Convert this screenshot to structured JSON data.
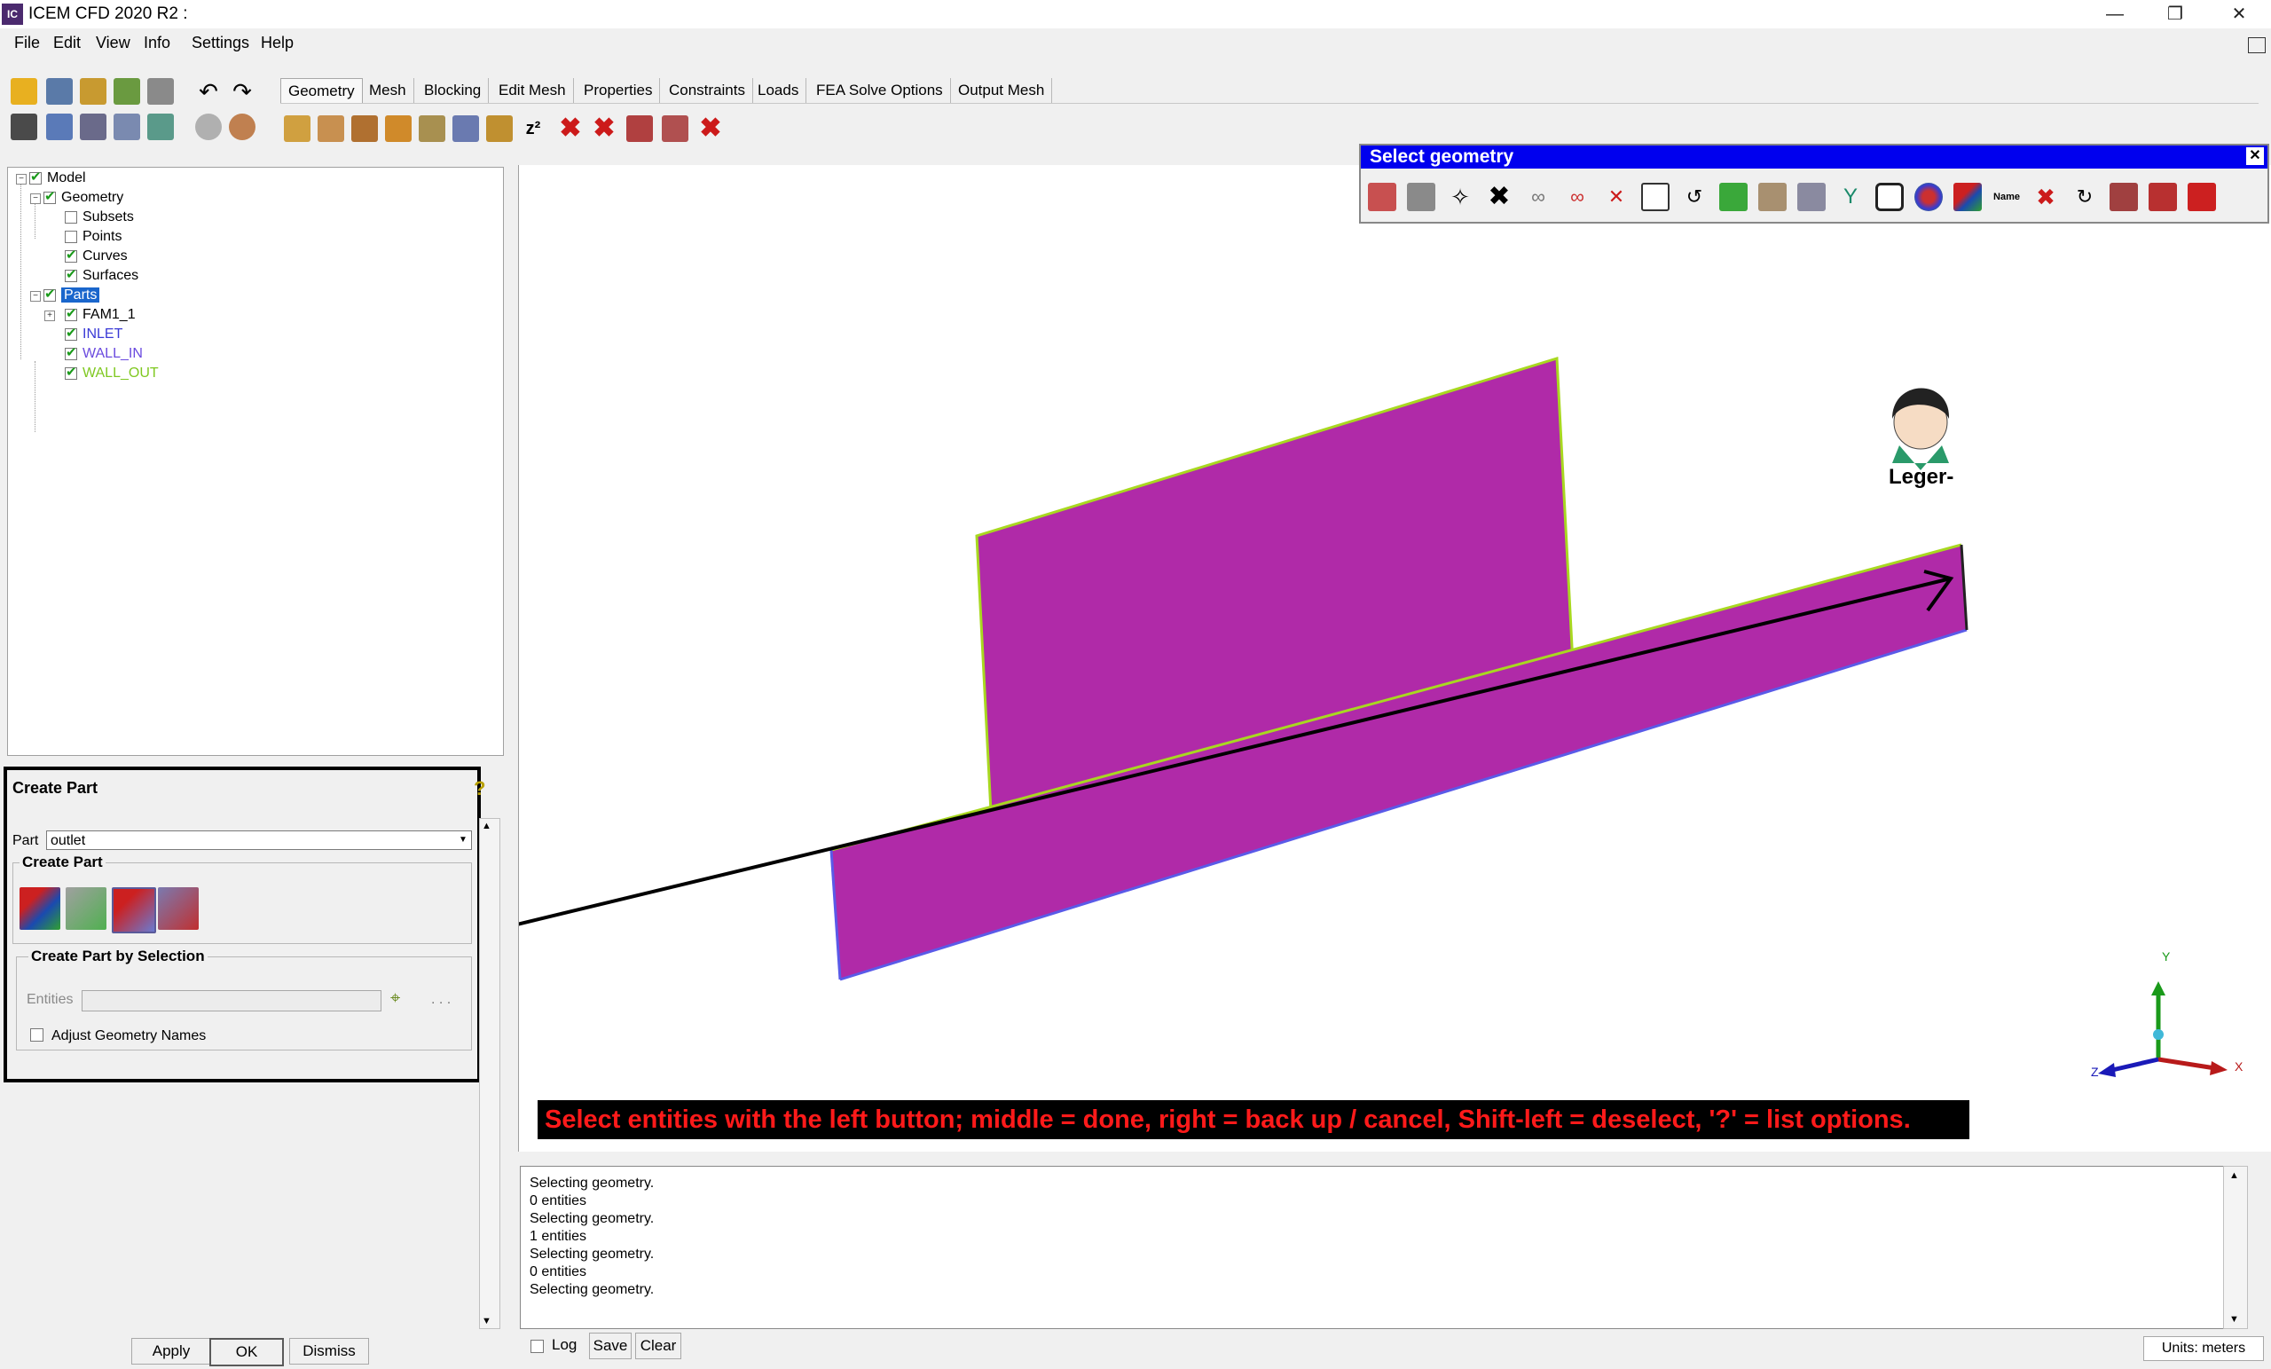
{
  "app": {
    "title": "ICEM CFD 2020 R2 :",
    "logo_text": "IC"
  },
  "window_controls": {
    "minimize": "—",
    "maximize": "❐",
    "close": "✕"
  },
  "menu": [
    "File",
    "Edit",
    "View",
    "Info",
    "Settings",
    "Help"
  ],
  "tabs": [
    "Geometry",
    "Mesh",
    "Blocking",
    "Edit Mesh",
    "Properties",
    "Constraints",
    "Loads",
    "FEA Solve Options",
    "Output Mesh"
  ],
  "tree": {
    "model": "Model",
    "geometry": "Geometry",
    "subsets": "Subsets",
    "points": "Points",
    "curves": "Curves",
    "surfaces": "Surfaces",
    "parts": "Parts",
    "part_items": [
      {
        "label": "FAM1_1",
        "color": "#000000"
      },
      {
        "label": "INLET",
        "color": "#3a3ad6"
      },
      {
        "label": "WALL_IN",
        "color": "#6a4adf"
      },
      {
        "label": "WALL_OUT",
        "color": "#7fc820"
      }
    ]
  },
  "create_part": {
    "title": "Create Part",
    "help_icon": "?",
    "part_label": "Part",
    "part_value": "outlet",
    "group_label": "Create Part",
    "selection_group_label": "Create Part by Selection",
    "entities_label": "Entities",
    "ellipsis": ". . .",
    "adjust_label": "Adjust Geometry Names"
  },
  "bottom_buttons": {
    "apply": "Apply",
    "ok": "OK",
    "dismiss": "Dismiss"
  },
  "select_geometry": {
    "title": "Select geometry",
    "close": "✕",
    "name_icon_text": "Name"
  },
  "viewport": {
    "message": "Select entities with the left button; middle = done, right = back up / cancel, Shift-left = deselect, '?' = list options.",
    "avatar_name": "Leger-",
    "axes": {
      "x": "X",
      "y": "Y",
      "z": "Z"
    },
    "surface_color": "#b02aa8"
  },
  "log": {
    "lines": [
      "Selecting geometry.",
      "0 entities",
      "Selecting geometry.",
      "1 entities",
      "Selecting geometry.",
      "0 entities",
      "Selecting geometry."
    ],
    "log_label": "Log",
    "save": "Save",
    "clear": "Clear",
    "units": "Units: meters"
  }
}
